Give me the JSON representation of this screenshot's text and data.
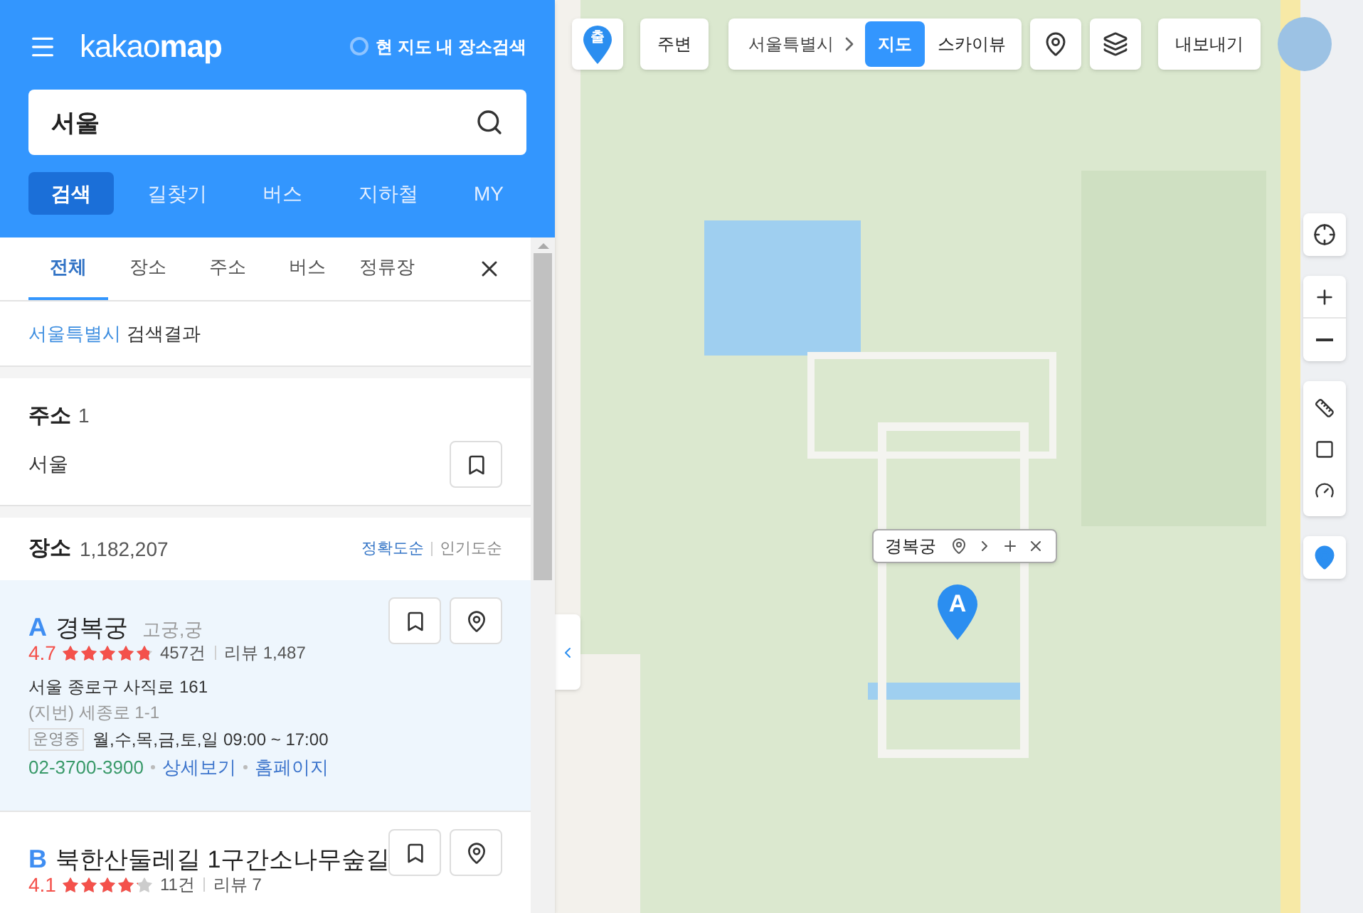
{
  "header": {
    "logo_light": "kakao",
    "logo_bold": "map",
    "area_search": {
      "label": "현 지도 내 장소검색",
      "checked": false
    }
  },
  "search": {
    "value": "서울"
  },
  "main_tabs": [
    {
      "label": "검색",
      "selected": true
    },
    {
      "label": "길찾기",
      "selected": false
    },
    {
      "label": "버스",
      "selected": false
    },
    {
      "label": "지하철",
      "selected": false
    },
    {
      "label": "MY",
      "selected": false
    }
  ],
  "filter_tabs": [
    {
      "label": "전체",
      "selected": true
    },
    {
      "label": "장소",
      "selected": false
    },
    {
      "label": "주소",
      "selected": false
    },
    {
      "label": "버스",
      "selected": false
    },
    {
      "label": "정류장",
      "selected": false
    }
  ],
  "result_header": {
    "region": "서울특별시",
    "suffix": "검색결과"
  },
  "address_section": {
    "title": "주소",
    "count": "1",
    "items": [
      "서울"
    ]
  },
  "place_section": {
    "title": "장소",
    "count": "1,182,207",
    "sorts": [
      {
        "label": "정확도순",
        "selected": true
      },
      {
        "label": "인기도순",
        "selected": false
      }
    ]
  },
  "places": [
    {
      "marker": "A",
      "name": "경복궁",
      "category": "고궁,궁",
      "rating": "4.7",
      "stars": 4.7,
      "rating_count": "457건",
      "reviews": "리뷰 1,487",
      "address": "서울 종로구 사직로 161",
      "lot_address": "(지번) 세종로 1-1",
      "status": "운영중",
      "hours": "월,수,목,금,토,일 09:00 ~ 17:00",
      "phone": "02-3700-3900",
      "links": [
        "상세보기",
        "홈페이지"
      ],
      "selected": true
    },
    {
      "marker": "B",
      "name": "북한산둘레길 1구간소나무숲길",
      "rating": "4.1",
      "stars": 4.1,
      "rating_count": "11건",
      "reviews": "리뷰 7",
      "selected": false
    }
  ],
  "map_toolbar": {
    "departure": "출",
    "nearby": "주변",
    "region": "서울특별시",
    "views": [
      {
        "label": "지도",
        "selected": true
      },
      {
        "label": "스카이뷰",
        "selected": false
      }
    ],
    "export": "내보내기"
  },
  "map_popup": {
    "title": "경복궁"
  },
  "map_marker": {
    "label": "A"
  }
}
